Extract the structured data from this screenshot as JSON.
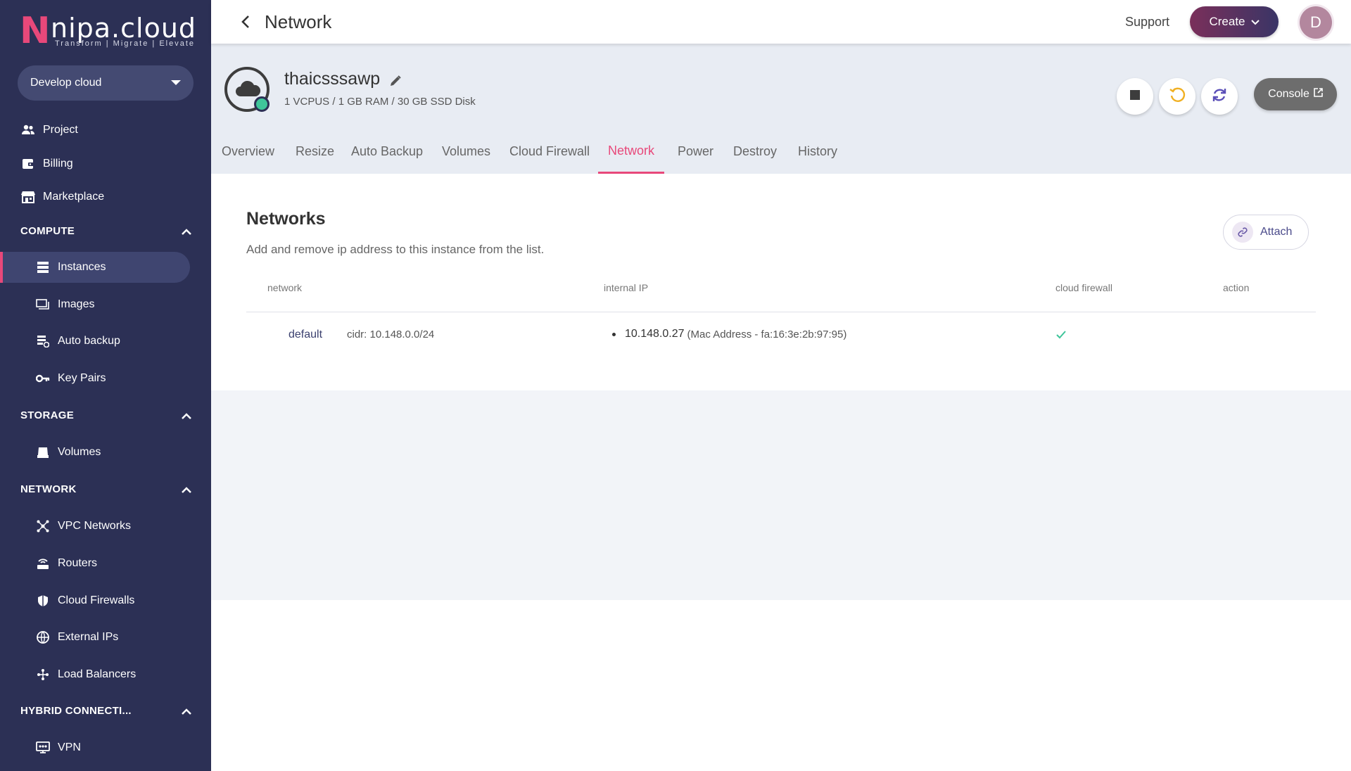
{
  "sidebar": {
    "logo": {
      "mark": "N",
      "text": "nipa.cloud",
      "tagline": "Transform  |  Migrate  |  Elevate"
    },
    "env_select": "Develop cloud",
    "items_top": [
      {
        "label": "Project",
        "icon": "people-icon"
      },
      {
        "label": "Billing",
        "icon": "wallet-icon"
      },
      {
        "label": "Marketplace",
        "icon": "store-icon"
      }
    ],
    "sections": {
      "compute": {
        "label": "COMPUTE",
        "items": [
          {
            "label": "Instances",
            "icon": "server-icon"
          },
          {
            "label": "Images",
            "icon": "images-icon"
          },
          {
            "label": "Auto backup",
            "icon": "backup-icon"
          },
          {
            "label": "Key Pairs",
            "icon": "key-icon"
          }
        ]
      },
      "storage": {
        "label": "STORAGE",
        "items": [
          {
            "label": "Volumes",
            "icon": "disk-icon"
          }
        ]
      },
      "network": {
        "label": "NETWORK",
        "items": [
          {
            "label": "VPC Networks",
            "icon": "vpc-icon"
          },
          {
            "label": "Routers",
            "icon": "router-icon"
          },
          {
            "label": "Cloud Firewalls",
            "icon": "shield-icon"
          },
          {
            "label": "External IPs",
            "icon": "globe-icon"
          },
          {
            "label": "Load Balancers",
            "icon": "load-balancer-icon"
          }
        ]
      },
      "hybrid": {
        "label": "HYBRID CONNECTI...",
        "items": [
          {
            "label": "VPN",
            "icon": "vpn-icon"
          }
        ]
      }
    }
  },
  "topbar": {
    "title": "Network",
    "support": "Support",
    "create": "Create",
    "avatar": "D"
  },
  "instance": {
    "name": "thaicsssawp",
    "spec": "1 VCPUS / 1 GB RAM / 30 GB SSD Disk",
    "console": "Console",
    "status_color": "#3fc59a"
  },
  "tabs": [
    "Overview",
    "Resize",
    "Auto Backup",
    "Volumes",
    "Cloud Firewall",
    "Network",
    "Power",
    "Destroy",
    "History"
  ],
  "active_tab": "Network",
  "networks": {
    "title": "Networks",
    "description": "Add and remove ip address to this instance from the list.",
    "attach": "Attach",
    "columns": [
      "network",
      "internal IP",
      "cloud firewall",
      "action"
    ],
    "rows": [
      {
        "network": "default",
        "cidr": "cidr: 10.148.0.0/24",
        "ip": "10.148.0.27",
        "mac": "(Mac Address - fa:16:3e:2b:97:95)",
        "firewall_enabled": true
      }
    ]
  },
  "colors": {
    "accent": "#e8487a",
    "sidebar": "#2c3055",
    "success": "#3fc59a"
  }
}
